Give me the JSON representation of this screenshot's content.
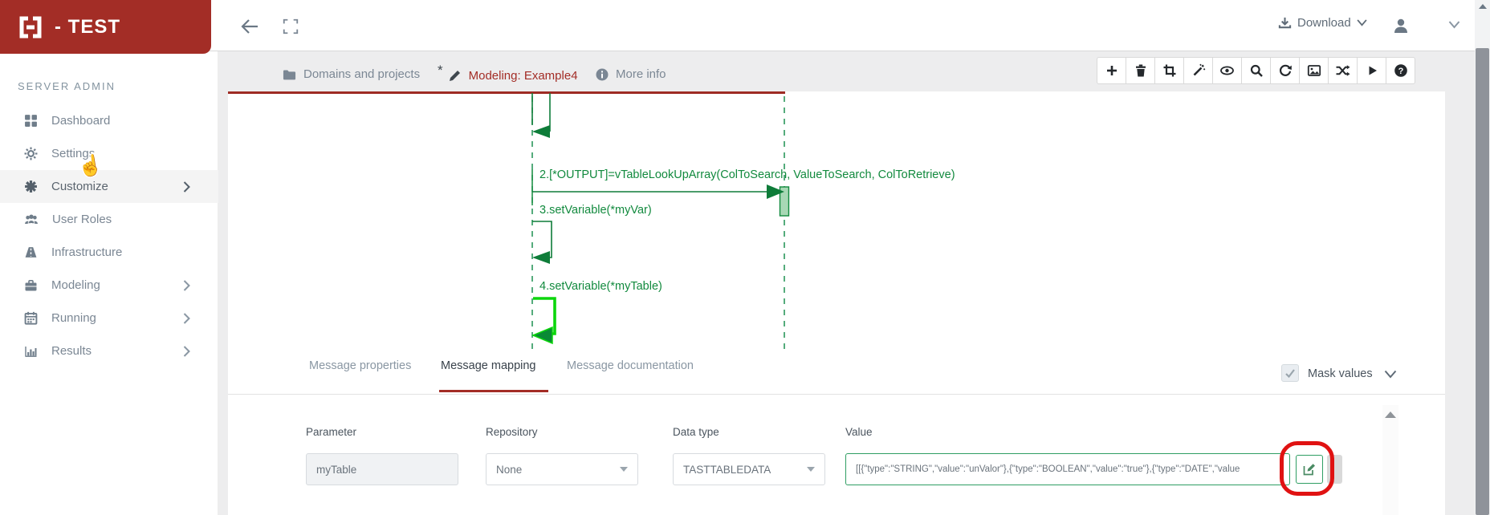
{
  "header": {
    "logo_text": "- TEST",
    "download_label": "Download"
  },
  "sidebar": {
    "section_label": "SERVER ADMIN",
    "items": [
      {
        "label": "Dashboard",
        "icon": "grid-icon",
        "chevron": false
      },
      {
        "label": "Settings",
        "icon": "gear-icon",
        "chevron": false
      },
      {
        "label": "Customize",
        "icon": "customize-icon",
        "chevron": true,
        "hovered": true
      },
      {
        "label": "User Roles",
        "icon": "users-icon",
        "chevron": false
      },
      {
        "label": "Infrastructure",
        "icon": "road-icon",
        "chevron": false
      },
      {
        "label": "Modeling",
        "icon": "briefcase-icon",
        "chevron": true
      },
      {
        "label": "Running",
        "icon": "calendar-icon",
        "chevron": true
      },
      {
        "label": "Results",
        "icon": "bar-chart-icon",
        "chevron": true
      }
    ]
  },
  "breadcrumbs": {
    "items": [
      {
        "label": "Domains and projects",
        "icon": "folder-icon"
      },
      {
        "label": "Modeling: Example4",
        "icon": "pencil-icon",
        "modified": "*"
      },
      {
        "label": "More info",
        "icon": "info-icon"
      }
    ]
  },
  "toolbar": {
    "icons": [
      "add",
      "delete",
      "crop",
      "magic-wand",
      "preview",
      "zoom",
      "refresh",
      "image",
      "shuffle",
      "run",
      "help"
    ]
  },
  "diagram": {
    "messages": [
      {
        "label": "2.[*OUTPUT]=vTableLookUpArray(ColToSearch, ValueToSearch, ColToRetrieve)"
      },
      {
        "label": "3.setVariable(*myVar)"
      },
      {
        "label": "4.setVariable(*myTable)",
        "selected": true
      }
    ],
    "colors": {
      "line": "#128a3e",
      "selected": "#0cd60c",
      "lifeline": "#1d9150"
    }
  },
  "panel": {
    "tabs": [
      {
        "label": "Message properties"
      },
      {
        "label": "Message mapping",
        "active": true
      },
      {
        "label": "Message documentation"
      }
    ],
    "mask_values": {
      "label": "Mask values",
      "checked": true
    },
    "form": {
      "fields": [
        {
          "label": "Parameter",
          "type": "input",
          "value": "myTable",
          "disabled": true
        },
        {
          "label": "Repository",
          "type": "select",
          "value": "None"
        },
        {
          "label": "Data type",
          "type": "select",
          "value": "TASTTABLEDATA"
        },
        {
          "label": "Value",
          "type": "input",
          "value": "[[{\"type\":\"STRING\",\"value\":\"unValor\"},{\"type\":\"BOOLEAN\",\"value\":\"true\"},{\"type\":\"DATE\",\"value"
        }
      ]
    }
  },
  "annotation": {
    "highlight_color": "#e01212"
  }
}
